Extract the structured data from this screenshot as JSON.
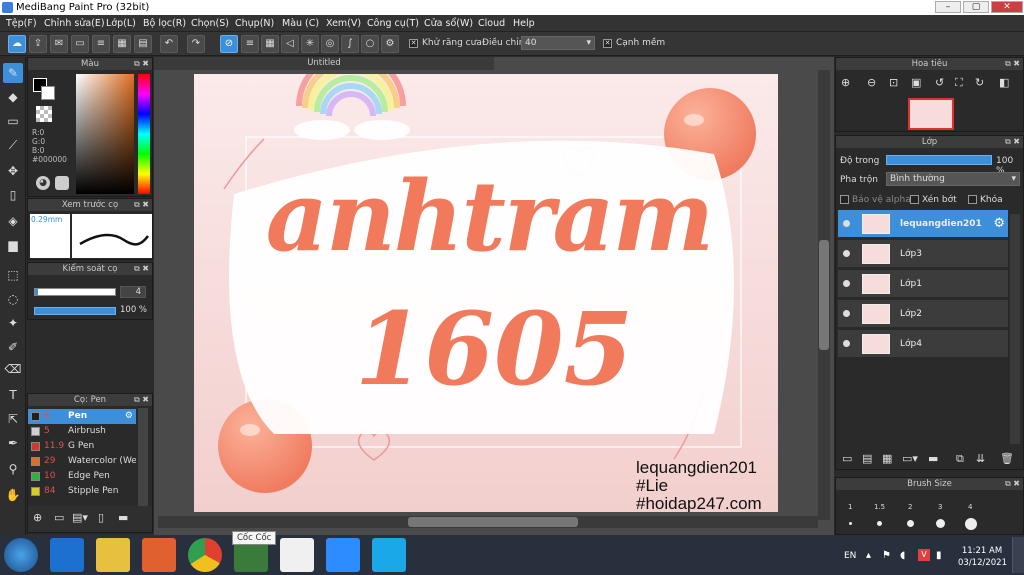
{
  "window": {
    "title": "MediBang Paint Pro (32bit)",
    "buttons": [
      "–",
      "▢",
      "✕"
    ]
  },
  "menu": [
    "Tệp(F)",
    "Chỉnh sửa(E)",
    "Lớp(L)",
    "Bộ lọc(R)",
    "Chọn(S)",
    "Chụp(N)",
    "Màu (C)",
    "Xem(V)",
    "Công cụ(T)",
    "Cửa sổ(W)",
    "Cloud",
    "Help"
  ],
  "toolbar": {
    "antialias_label": "Khử răng cưa",
    "adjust_label": "Điều chỉnh",
    "adjust_value": "40",
    "edge_label": "Cạnh mềm"
  },
  "color_panel": {
    "title": "Màu",
    "r": "R:0",
    "g": "G:0",
    "b": "B:0",
    "hex": "#000000"
  },
  "brush_preview": {
    "title": "Xem trước cọ",
    "size": "0.29mm"
  },
  "brush_control": {
    "title": "Kiểm soát cọ",
    "size_value": "4",
    "opacity_value": "100 %"
  },
  "brush_list": {
    "title": "Cọ: Pen",
    "items": [
      {
        "size": "4",
        "name": "Pen",
        "color": "#222222"
      },
      {
        "size": "5",
        "name": "Airbrush",
        "color": "#cfcfcf"
      },
      {
        "size": "11.9",
        "name": "G Pen",
        "color": "#e03030"
      },
      {
        "size": "29",
        "name": "Watercolor (Wet",
        "color": "#e07020"
      },
      {
        "size": "10",
        "name": "Edge Pen",
        "color": "#30b040"
      },
      {
        "size": "84",
        "name": "Stipple Pen",
        "color": "#d8d020"
      }
    ]
  },
  "document": {
    "tab": "Untitled"
  },
  "artwork_text": {
    "line1": "anhtram",
    "line2": "1605",
    "tag1": "lequangdien201",
    "tag2": "#Lie",
    "tag3": "#hoidap247.com"
  },
  "navigator": {
    "title": "Hoa tiêu"
  },
  "layer_panel": {
    "title": "Lớp",
    "opacity_label": "Độ trong",
    "opacity_value": "100 %",
    "blend_label": "Pha trộn",
    "blend_value": "Bình thường",
    "protect_alpha": "Bảo vệ alpha",
    "clipping": "Xén bớt",
    "lock": "Khóa",
    "layers": [
      "lequangdien201",
      "Lớp3",
      "Lớp1",
      "Lớp2",
      "Lớp4"
    ]
  },
  "brush_size": {
    "title": "Brush Size",
    "sizes": [
      "1",
      "1.5",
      "2",
      "3",
      "4"
    ]
  },
  "taskbar": {
    "tooltip": "Cốc Cốc",
    "lang": "EN",
    "time": "11:21 AM",
    "date": "03/12/2021"
  },
  "colors": {
    "accent": "#3c8fd8",
    "peach": "#f28a6a"
  }
}
